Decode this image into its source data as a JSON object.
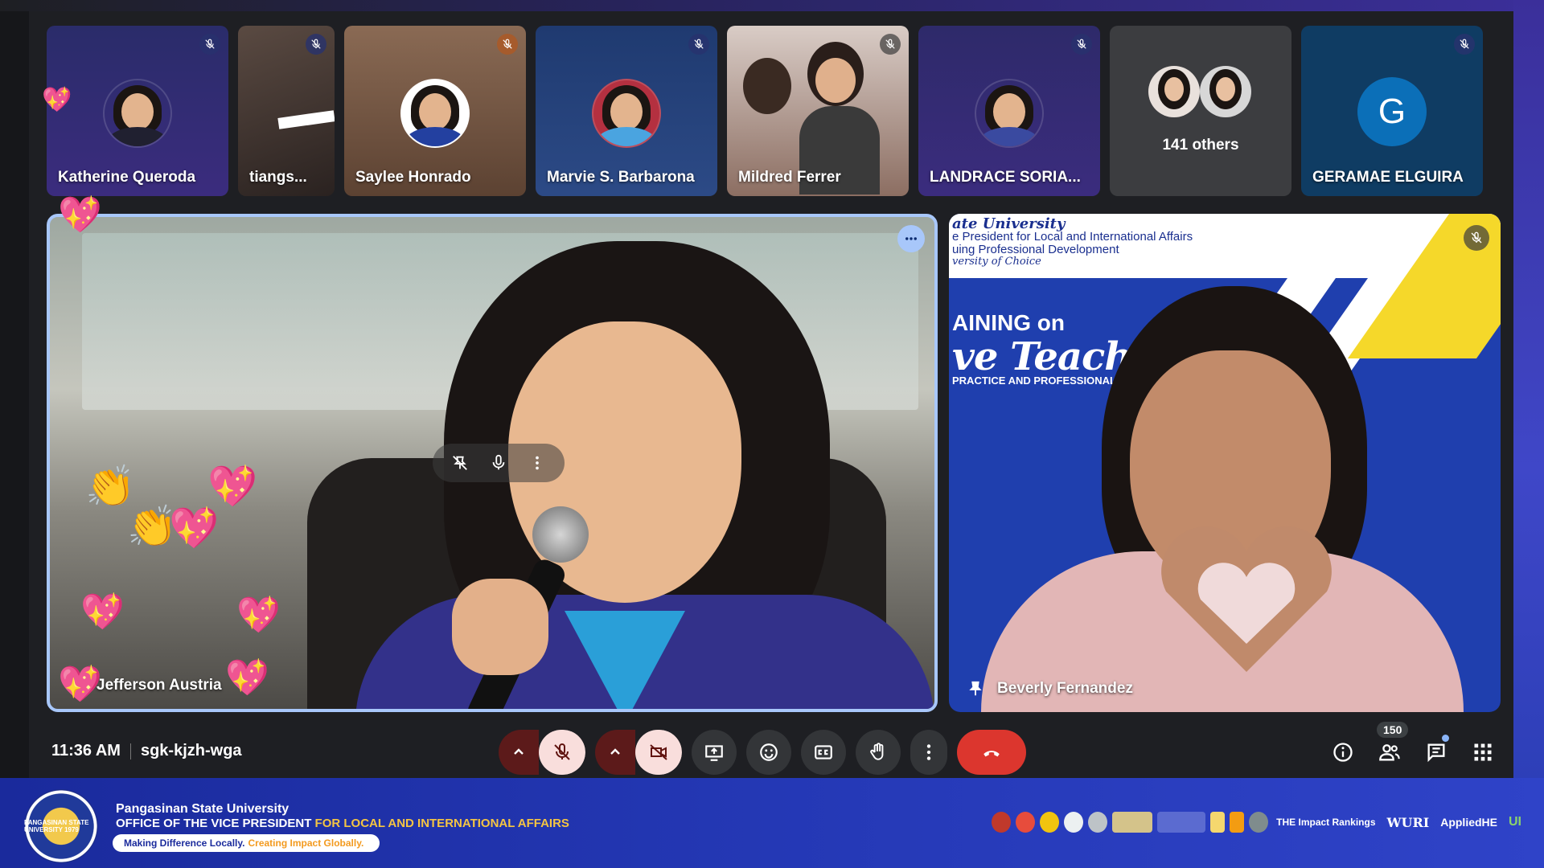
{
  "participants_strip": [
    {
      "name": "Katherine Queroda",
      "muted": true,
      "tile_color": "#2a2c6a"
    },
    {
      "name": "tiangs...",
      "muted": true,
      "tile_color": "#4b3e38"
    },
    {
      "name": "Saylee Honrado",
      "muted": true,
      "tile_color": "#7a5a44"
    },
    {
      "name": "Marvie S. Barbarona",
      "muted": true,
      "tile_color": "#2b3c6e"
    },
    {
      "name": "Mildred Ferrer",
      "muted": true,
      "tile_color": "#8c6e62"
    },
    {
      "name": "LANDRACE SORIA...",
      "muted": true,
      "tile_color": "#2e2a6a"
    },
    {
      "others_label": "141 others"
    },
    {
      "name": "GERAMAE ELGUIRA",
      "initial": "G",
      "muted": true,
      "tile_color": "#0f3c63"
    }
  ],
  "main_left": {
    "name": "Jefferson Austria"
  },
  "main_right": {
    "name": "Beverly Fernandez",
    "slide": {
      "line1": "ate University",
      "line2": "e President for Local and International Affairs",
      "line3": "uing Professional Development",
      "line4": "versity of Choice",
      "title1": "AINING on",
      "title2": "ve Teachin",
      "sub": "PRACTICE AND PROFESSIONAL GROWTH"
    }
  },
  "meeting": {
    "time": "11:36 AM",
    "code": "sgk-kjzh-wga",
    "participant_count": "150"
  },
  "controls": {
    "icons": [
      "caret-up-icon",
      "mic-off-icon",
      "caret-up-icon",
      "camera-off-icon",
      "present-screen-icon",
      "emoji-icon",
      "captions-icon",
      "raise-hand-icon",
      "more-options-icon",
      "leave-call-icon"
    ]
  },
  "right_tools": {
    "icons": [
      "info-icon",
      "people-icon",
      "chat-icon",
      "activities-icon"
    ]
  },
  "banner": {
    "university": "Pangasinan State University",
    "office_part1": "OFFICE OF THE VICE PRESIDENT ",
    "office_part2": "FOR LOCAL AND INTERNATIONAL AFFAIRS",
    "tagline_part1": "Making Difference Locally.",
    "tagline_part2": "Creating Impact Globally.",
    "seal_text": "PANGASINAN STATE UNIVERSITY 1979",
    "logos": [
      "THE Impact Rankings",
      "WURI",
      "AppliedHE",
      "UI"
    ]
  },
  "colors": {
    "accent_border": "#a8c7fa",
    "leave_red": "#dc362e",
    "muted_pill": "#f9dedc",
    "banner_blue": "#2438b5",
    "banner_gold": "#f5c542"
  }
}
